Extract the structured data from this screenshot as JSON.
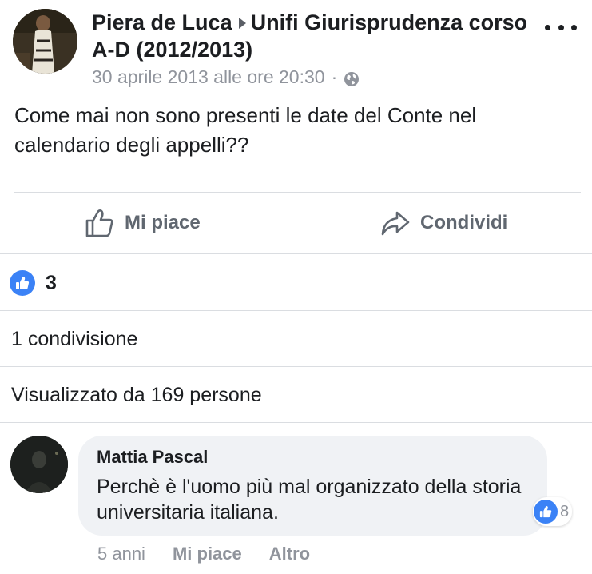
{
  "post": {
    "author": "Piera de Luca",
    "group": "Unifi Giurisprudenza corso A-D (2012/2013)",
    "timestamp": "30 aprile 2013 alle ore 20:30",
    "separator": "·",
    "privacy_icon": "globe-icon",
    "more_icon": "more-dots-icon",
    "body": "Come mai non sono presenti le date del Conte nel calendario degli appelli??"
  },
  "actions": {
    "like_label": "Mi piace",
    "share_label": "Condividi"
  },
  "stats": {
    "reaction_count": "3",
    "shares_text": "1 condivisione",
    "views_text": "Visualizzato da 169 persone"
  },
  "comment": {
    "author": "Mattia Pascal",
    "text": "Perchè è l'uomo più mal organizzato della storia universitaria italiana.",
    "reaction_count": "8",
    "age": "5 anni",
    "like_label": "Mi piace",
    "more_label": "Altro"
  },
  "colors": {
    "like_blue": "#3b82f6",
    "meta_gray": "#90949c",
    "bubble_bg": "#f0f2f5"
  }
}
